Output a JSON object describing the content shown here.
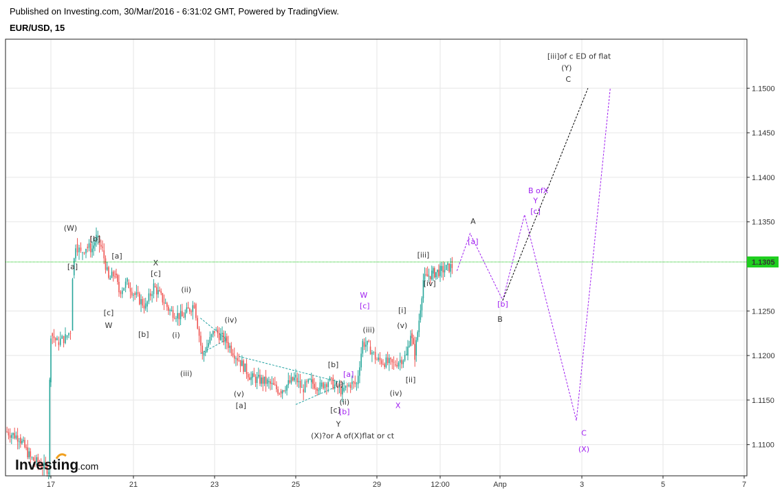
{
  "header": {
    "published": "Published on Investing.com, 30/Mar/2016 - 6:31:02 GMT, Powered by TradingView.",
    "symbol": "EUR/USD, 15"
  },
  "logo": {
    "brand": "Investing",
    "suffix": ".com"
  },
  "colors": {
    "up": "#26a69a",
    "down": "#ef5350",
    "grid": "#e6e6e6",
    "price_line": "#00c000",
    "magenta": "#a020f0",
    "teal": "#20a0a0",
    "black_path": "#000000",
    "price_tag": "#1fcf1f"
  },
  "chart_data": {
    "type": "candlestick",
    "title": "EUR/USD, 15",
    "ylim": [
      1.1065,
      1.1555
    ],
    "y_ticks": [
      "1.1500",
      "1.1450",
      "1.1400",
      "1.1350",
      "1.1250",
      "1.1200",
      "1.1150",
      "1.1100"
    ],
    "x_ticks": [
      "17",
      "21",
      "23",
      "25",
      "29",
      "12:00",
      "Апр",
      "3",
      "5",
      "7"
    ],
    "x_tick_index": [
      17,
      21,
      23,
      25,
      29,
      30.5,
      31.5,
      33,
      35,
      37
    ],
    "last_price": "1.1305",
    "price_path": [
      [
        15.0,
        1.1115
      ],
      [
        15.6,
        1.1108
      ],
      [
        16.1,
        1.1085
      ],
      [
        16.5,
        1.1078
      ],
      [
        16.9,
        1.1072
      ],
      [
        16.95,
        1.117
      ],
      [
        17.0,
        1.1225
      ],
      [
        17.3,
        1.1215
      ],
      [
        17.7,
        1.122
      ],
      [
        17.95,
        1.1228
      ],
      [
        18.05,
        1.129
      ],
      [
        18.2,
        1.1325
      ],
      [
        18.45,
        1.1315
      ],
      [
        18.7,
        1.1322
      ],
      [
        19.0,
        1.132
      ],
      [
        19.2,
        1.1332
      ],
      [
        19.5,
        1.1318
      ],
      [
        19.8,
        1.1285
      ],
      [
        20.1,
        1.1292
      ],
      [
        20.3,
        1.1272
      ],
      [
        20.7,
        1.1282
      ],
      [
        21.0,
        1.127
      ],
      [
        21.3,
        1.1255
      ],
      [
        21.5,
        1.1278
      ],
      [
        21.9,
        1.125
      ],
      [
        22.2,
        1.1243
      ],
      [
        22.5,
        1.1258
      ],
      [
        22.7,
        1.12
      ],
      [
        23.0,
        1.1228
      ],
      [
        23.3,
        1.1215
      ],
      [
        23.6,
        1.1195
      ],
      [
        23.9,
        1.1175
      ],
      [
        24.3,
        1.117
      ],
      [
        24.6,
        1.116
      ],
      [
        25.0,
        1.1175
      ],
      [
        25.3,
        1.1162
      ],
      [
        25.7,
        1.117
      ],
      [
        26.2,
        1.1165
      ],
      [
        26.6,
        1.1172
      ],
      [
        27.0,
        1.1165
      ],
      [
        27.3,
        1.116
      ],
      [
        27.7,
        1.1168
      ],
      [
        28.0,
        1.1168
      ],
      [
        28.3,
        1.1215
      ],
      [
        28.6,
        1.121
      ],
      [
        29.0,
        1.1195
      ],
      [
        29.4,
        1.119
      ],
      [
        29.7,
        1.12
      ],
      [
        29.8,
        1.1225
      ],
      [
        29.9,
        1.12
      ],
      [
        30.0,
        1.124
      ],
      [
        30.1,
        1.1285
      ],
      [
        30.3,
        1.1292
      ],
      [
        30.5,
        1.1295
      ],
      [
        30.7,
        1.13
      ]
    ],
    "projections": {
      "magenta_path": [
        [
          30.78,
          1.1295
        ],
        [
          31.0,
          1.1337
        ],
        [
          31.55,
          1.1262
        ],
        [
          31.95,
          1.1358
        ],
        [
          32.9,
          1.1127
        ],
        [
          33.7,
          1.15
        ]
      ],
      "black_path": [
        [
          31.55,
          1.1262
        ],
        [
          33.15,
          1.15
        ]
      ]
    },
    "triangles": [
      {
        "lines": [
          [
            [
              22.65,
              1.1242
            ],
            [
              23.3,
              1.1218
            ]
          ],
          [
            [
              22.65,
              1.1202
            ],
            [
              23.3,
              1.1218
            ]
          ]
        ]
      },
      {
        "lines": [
          [
            [
              23.6,
              1.1199
            ],
            [
              27.2,
              1.117
            ]
          ],
          [
            [
              25.0,
              1.1145
            ],
            [
              27.5,
              1.117
            ]
          ]
        ]
      }
    ],
    "annotations": [
      {
        "text": "[iii]of c ED of flat",
        "at": [
          32.95,
          1.1533
        ],
        "color": "#333333",
        "size": 12
      },
      {
        "text": "(Y)",
        "at": [
          32.72,
          1.152
        ],
        "color": "#333333",
        "size": 12
      },
      {
        "text": "C",
        "at": [
          32.75,
          1.1507
        ],
        "color": "#333333",
        "size": 12
      },
      {
        "text": "(W)",
        "at": [
          17.95,
          1.134
        ],
        "color": "#333333",
        "size": 12
      },
      {
        "text": "[b]",
        "at": [
          19.15,
          1.1328
        ],
        "color": "#333333",
        "size": 10
      },
      {
        "text": "[a]",
        "at": [
          18.05,
          1.1297
        ],
        "color": "#333333",
        "size": 10
      },
      {
        "text": "[a]",
        "at": [
          20.2,
          1.1309
        ],
        "color": "#333333",
        "size": 10
      },
      {
        "text": "X",
        "at": [
          21.55,
          1.1301
        ],
        "color": "#333333",
        "size": 11
      },
      {
        "text": "[c]",
        "at": [
          21.55,
          1.1289
        ],
        "color": "#333333",
        "size": 10
      },
      {
        "text": "(ii)",
        "at": [
          22.3,
          1.1271
        ],
        "color": "#333333",
        "size": 10
      },
      {
        "text": "[c]",
        "at": [
          19.8,
          1.1245
        ],
        "color": "#333333",
        "size": 10
      },
      {
        "text": "W",
        "at": [
          19.8,
          1.1231
        ],
        "color": "#333333",
        "size": 11
      },
      {
        "text": "[b]",
        "at": [
          21.25,
          1.1221
        ],
        "color": "#333333",
        "size": 10
      },
      {
        "text": "(i)",
        "at": [
          22.05,
          1.122
        ],
        "color": "#333333",
        "size": 10
      },
      {
        "text": "(iv)",
        "at": [
          23.4,
          1.1237
        ],
        "color": "#333333",
        "size": 10
      },
      {
        "text": "(iii)",
        "at": [
          22.3,
          1.1177
        ],
        "color": "#333333",
        "size": 10
      },
      {
        "text": "(v)",
        "at": [
          23.6,
          1.1154
        ],
        "color": "#333333",
        "size": 10
      },
      {
        "text": "[a]",
        "at": [
          23.65,
          1.1141
        ],
        "color": "#333333",
        "size": 10
      },
      {
        "text": "[b]",
        "at": [
          26.85,
          1.1187
        ],
        "color": "#333333",
        "size": 10
      },
      {
        "text": "(i)",
        "at": [
          27.15,
          1.1165
        ],
        "color": "#333333",
        "size": 10
      },
      {
        "text": "(ii)",
        "at": [
          27.4,
          1.1145
        ],
        "color": "#333333",
        "size": 10
      },
      {
        "text": "[c]",
        "at": [
          26.95,
          1.1136
        ],
        "color": "#333333",
        "size": 10
      },
      {
        "text": "Y",
        "at": [
          27.1,
          1.112
        ],
        "color": "#333333",
        "size": 11
      },
      {
        "text": "(X)?or A of(X)flat or ct",
        "at": [
          27.8,
          1.1107
        ],
        "color": "#333333",
        "size": 12
      },
      {
        "text": "(iii)",
        "at": [
          28.6,
          1.1226
        ],
        "color": "#333333",
        "size": 10
      },
      {
        "text": "(iv)",
        "at": [
          29.45,
          1.1155
        ],
        "color": "#333333",
        "size": 10
      },
      {
        "text": "[ii]",
        "at": [
          29.8,
          1.117
        ],
        "color": "#333333",
        "size": 10
      },
      {
        "text": "[i]",
        "at": [
          29.6,
          1.1248
        ],
        "color": "#333333",
        "size": 10
      },
      {
        "text": "(v)",
        "at": [
          29.6,
          1.1231
        ],
        "color": "#333333",
        "size": 10
      },
      {
        "text": "[iii]",
        "at": [
          30.1,
          1.131
        ],
        "color": "#333333",
        "size": 10
      },
      {
        "text": "[iv]",
        "at": [
          30.25,
          1.1278
        ],
        "color": "#333333",
        "size": 10
      },
      {
        "text": "A",
        "at": [
          31.05,
          1.1348
        ],
        "color": "#333333",
        "size": 12
      },
      {
        "text": "B",
        "at": [
          31.5,
          1.1238
        ],
        "color": "#333333",
        "size": 12
      },
      {
        "text": "W",
        "at": [
          28.35,
          1.1265
        ],
        "color": "#a020f0",
        "size": 12
      },
      {
        "text": "[c]",
        "at": [
          28.4,
          1.1253
        ],
        "color": "#a020f0",
        "size": 10
      },
      {
        "text": "[a]",
        "at": [
          27.6,
          1.1176
        ],
        "color": "#a020f0",
        "size": 10
      },
      {
        "text": "[b]",
        "at": [
          27.4,
          1.1134
        ],
        "color": "#a020f0",
        "size": 10
      },
      {
        "text": "X",
        "at": [
          29.5,
          1.1141
        ],
        "color": "#a020f0",
        "size": 12
      },
      {
        "text": "[a]",
        "at": [
          31.05,
          1.1325
        ],
        "color": "#a020f0",
        "size": 10
      },
      {
        "text": "[b]",
        "at": [
          31.55,
          1.1255
        ],
        "color": "#a020f0",
        "size": 10
      },
      {
        "text": "B ofX",
        "at": [
          32.2,
          1.1382
        ],
        "color": "#a020f0",
        "size": 12
      },
      {
        "text": "Y",
        "at": [
          32.15,
          1.1371
        ],
        "color": "#a020f0",
        "size": 12
      },
      {
        "text": "[c]",
        "at": [
          32.15,
          1.1359
        ],
        "color": "#a020f0",
        "size": 10
      },
      {
        "text": "C",
        "at": [
          33.05,
          1.111
        ],
        "color": "#a020f0",
        "size": 12
      },
      {
        "text": "(X)",
        "at": [
          33.05,
          1.1092
        ],
        "color": "#a020f0",
        "size": 12
      }
    ]
  }
}
